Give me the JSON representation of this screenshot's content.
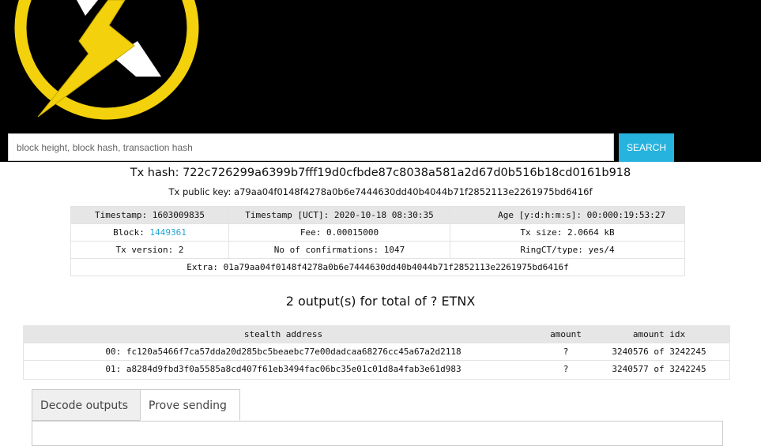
{
  "search": {
    "placeholder": "block height, block hash, transaction hash",
    "button_label": "SEARCH"
  },
  "tx": {
    "hash_label": "Tx hash: 722c726299a6399b7fff19d0cfbde87c8038a581a2d67d0b516b18cd0161b918",
    "pubkey_label": "Tx public key: a79aa04f0148f4278a0b6e7444630dd40b4044b71f2852113e2261975bd6416f"
  },
  "info": {
    "timestamp": "Timestamp: 1603009835",
    "timestamp_utc": "Timestamp [UCT]: 2020-10-18 08:30:35",
    "age": "Age [y:d:h:m:s]: 00:000:19:53:27",
    "block_prefix": "Block: ",
    "block_value": "1449361",
    "fee": "Fee: 0.00015000",
    "tx_size": "Tx size: 2.0664 kB",
    "tx_version": "Tx version: 2",
    "confirmations": "No of confirmations: 1047",
    "ringct": "RingCT/type: yes/4",
    "extra": "Extra: 01a79aa04f0148f4278a0b6e7444630dd40b4044b71f2852113e2261975bd6416f"
  },
  "outputs": {
    "title": "2 output(s) for total of ? ETNX",
    "headers": [
      "stealth address",
      "amount",
      "amount idx"
    ],
    "rows": [
      {
        "address": "00: fc120a5466f7ca57dda20d285bc5beaebc77e00dadcaa68276cc45a67a2d2118",
        "amount": "?",
        "idx": "3240576 of 3242245"
      },
      {
        "address": "01: a8284d9fbd3f0a5585a8cd407f61eb3494fac06bc35e01c01d8a4fab3e61d983",
        "amount": "?",
        "idx": "3240577 of 3242245"
      }
    ]
  },
  "tabs": [
    {
      "label": "Decode outputs"
    },
    {
      "label": "Prove sending"
    }
  ],
  "colors": {
    "header_bg": "#000000",
    "logo_yellow": "#f3d10c",
    "search_button": "#26b3de",
    "link": "#26a5d6"
  },
  "logo_icon": "lightning-bolt-logo"
}
